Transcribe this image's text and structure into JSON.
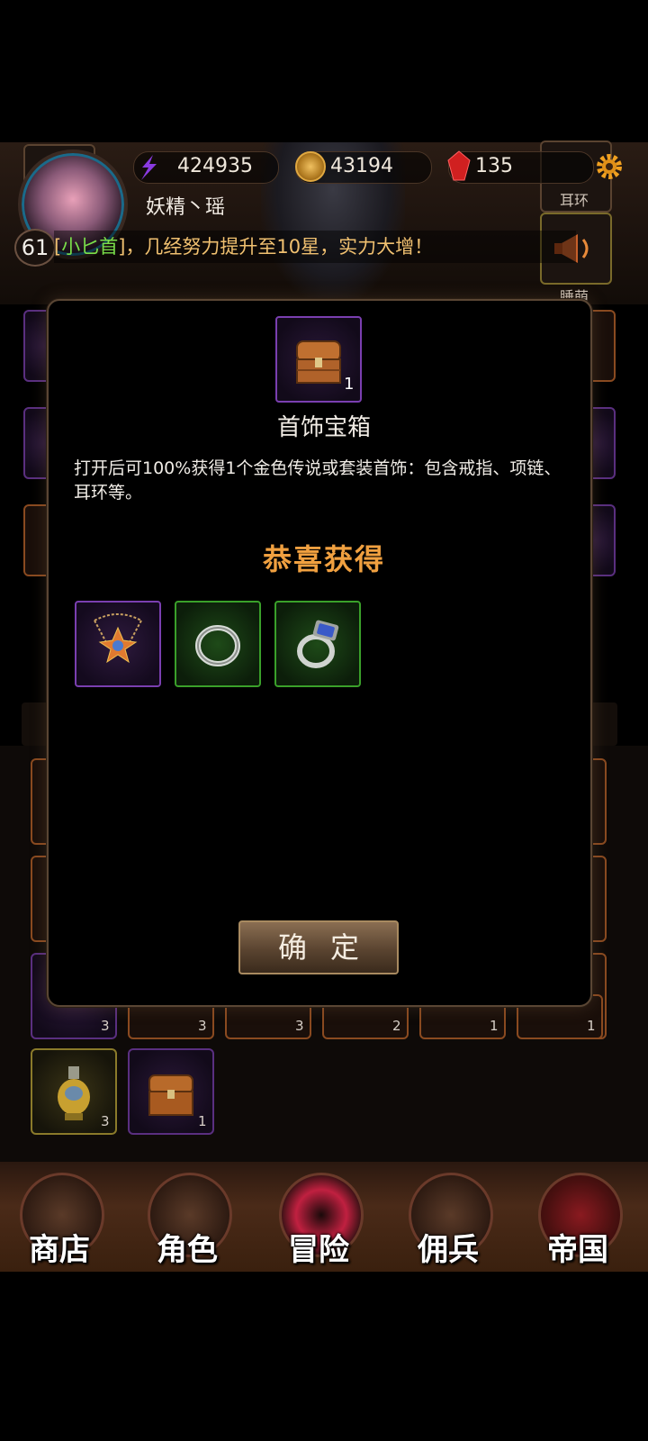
{
  "resources": {
    "energy": "424935",
    "gold": "43194",
    "gems": "135"
  },
  "player": {
    "name": "妖精丶瑶",
    "level": "61"
  },
  "news": {
    "prefix": "[",
    "highlight": "小匕首",
    "rest": "]，几经努力提升至10星，实力大增！"
  },
  "side_slots": {
    "earring_label": "耳环",
    "right_bottom_label": "睡萌"
  },
  "modal": {
    "item_name": "首饰宝箱",
    "item_count": "1",
    "description": "打开后可100%获得1个金色传说或套装首饰：包含戒指、项链、耳环等。",
    "congrats": "恭喜获得",
    "rewards": [
      {
        "name": "necklace",
        "rarity": "purple"
      },
      {
        "name": "ring",
        "rarity": "green"
      },
      {
        "name": "gem-ring",
        "rarity": "green"
      }
    ],
    "confirm": "确定"
  },
  "inventory": {
    "counts": [
      "3",
      "3",
      "3",
      "2",
      "1",
      "1",
      "3",
      "1"
    ]
  },
  "nav": {
    "items": [
      {
        "label": "商店"
      },
      {
        "label": "角色"
      },
      {
        "label": "冒险"
      },
      {
        "label": "佣兵"
      },
      {
        "label": "帝国"
      }
    ]
  },
  "colors": {
    "accent_orange": "#f0a040",
    "highlight_green": "#7adf4a",
    "rarity_purple": "#7a3fb0",
    "rarity_green": "#3aa02a"
  }
}
